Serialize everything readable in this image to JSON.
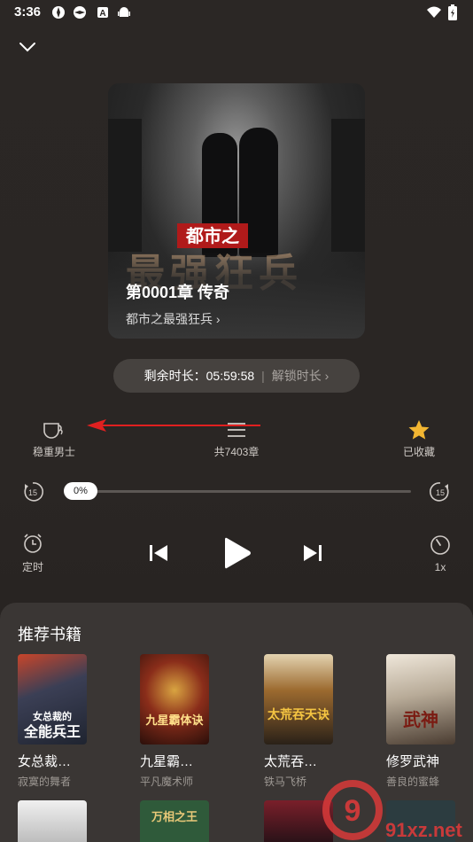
{
  "status_bar": {
    "time": "3:36"
  },
  "player": {
    "cover": {
      "overlay_small": "都市之",
      "overlay_big": "最强狂兵",
      "chapter_title": "第0001章 传奇",
      "book_name": "都市之最强狂兵 ›"
    },
    "remaining": {
      "label": "剩余时长：05:59:58",
      "separator": "|",
      "unlock": "解锁时长 ›"
    },
    "options": {
      "voice": "稳重男士",
      "chapters": "共7403章",
      "favorite": "已收藏"
    },
    "progress": {
      "percent_label": "0%",
      "value": 0
    },
    "controls": {
      "rewind": "15",
      "forward": "15",
      "timer": "定时",
      "speed": "1x"
    }
  },
  "recommend": {
    "title": "推荐书籍",
    "books": [
      {
        "title": "女总裁…",
        "author": "寂寞的舞者",
        "cover_text": "全能兵王",
        "cover_sub": "女总裁的"
      },
      {
        "title": "九星霸…",
        "author": "平凡魔术师",
        "cover_text": "九星霸体诀",
        "cover_sub": ""
      },
      {
        "title": "太荒吞…",
        "author": "铁马飞桥",
        "cover_text": "太荒吞天诀",
        "cover_sub": ""
      },
      {
        "title": "修罗武神",
        "author": "善良的蜜蜂",
        "cover_text": "武神",
        "cover_sub": ""
      }
    ],
    "row2_covers": [
      "",
      "万相之王",
      "",
      ""
    ]
  },
  "colors": {
    "favorite_star": "#f2b632",
    "arrow": "#e02020",
    "panel": "#3a3634"
  },
  "watermark": {
    "text": "91xz.net"
  }
}
